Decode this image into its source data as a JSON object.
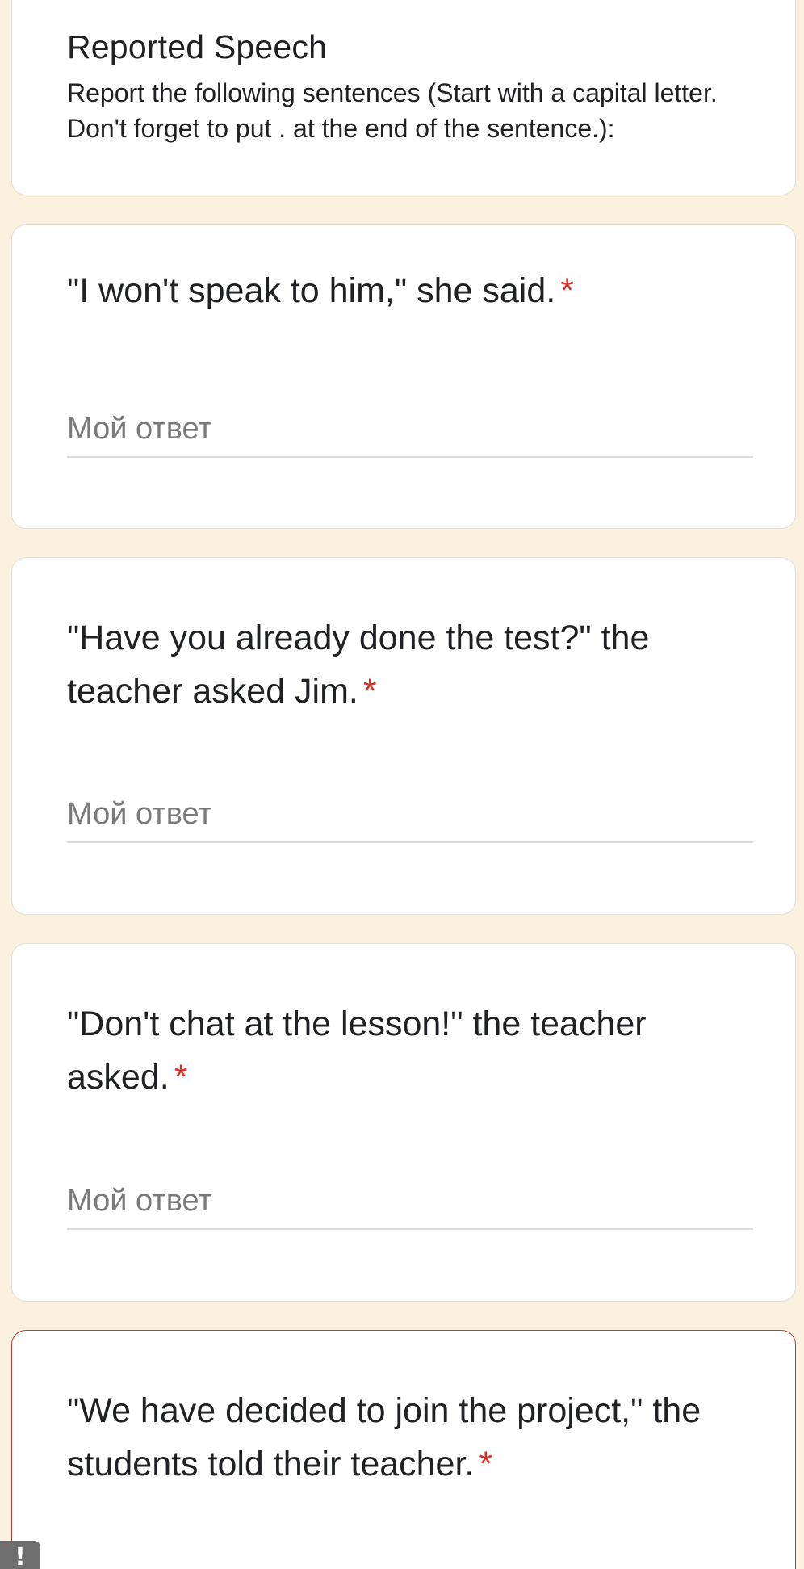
{
  "form": {
    "title": "Reported Speech",
    "description": "Report the following sentences (Start with a capital letter. Don't forget to put . at the end of the sentence.):"
  },
  "required_marker": "*",
  "answer_placeholder": "Мой ответ",
  "questions": [
    {
      "text": "\"I won't speak to him,\" she said."
    },
    {
      "text": "\"Have you already done the test?\" the teacher asked Jim."
    },
    {
      "text": "\"Don't chat at the lesson!\" the teacher asked."
    },
    {
      "text": "\"We have decided to join the project,\" the students told their teacher."
    }
  ],
  "report_button": {
    "label": "!"
  },
  "colors": {
    "background": "#fcf0de",
    "required": "#d93025",
    "error_border": "#b3423a"
  }
}
